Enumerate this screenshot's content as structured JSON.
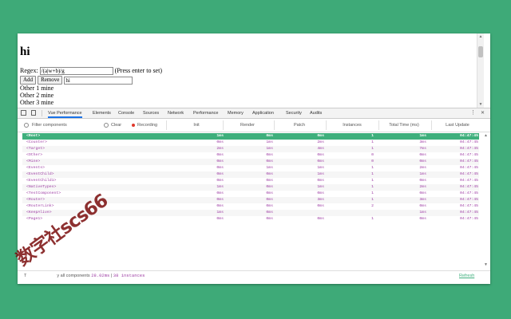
{
  "page": {
    "heading": "hi",
    "regex_label": "Regex:",
    "regex_value": "/(a|w+b)/g",
    "regex_hint": "(Press enter to set)",
    "add_button": "Add",
    "remove_button": "Remove",
    "new_item_value": "hi",
    "items": [
      "Other 1 mine",
      "Other 2 mine",
      "Other 3 mine"
    ]
  },
  "devtools": {
    "tabs": [
      "Vue Performance",
      "Elements",
      "Console",
      "Sources",
      "Network",
      "Performance",
      "Memory",
      "Application",
      "Security",
      "Audits"
    ],
    "active_tab": "Vue Performance",
    "accent": "#3eaf7c",
    "toolbar": {
      "filter_placeholder": "Filter components",
      "clear_label": "Clear",
      "recording_label": "Recording"
    },
    "columns": [
      "Init",
      "Render",
      "Patch",
      "Instances",
      "Total Time (ms)",
      "Last Update"
    ],
    "rows": [
      {
        "name": "<Root>",
        "init": "1ms",
        "render": "0ms",
        "patch": "0ms",
        "instances": "1",
        "total": "1ms",
        "last": "04:47:45",
        "selected": true
      },
      {
        "name": "<Counter>",
        "init": "0ms",
        "render": "1ms",
        "patch": "2ms",
        "instances": "1",
        "total": "3ms",
        "last": "04:47:45"
      },
      {
        "name": "<Target>",
        "init": "2ms",
        "render": "1ms",
        "patch": "4ms",
        "instances": "1",
        "total": "7ms",
        "last": "04:47:45"
      },
      {
        "name": "<Other>",
        "init": "0ms",
        "render": "0ms",
        "patch": "0ms",
        "instances": "0",
        "total": "0ms",
        "last": "04:47:45"
      },
      {
        "name": "<Mine>",
        "init": "0ms",
        "render": "0ms",
        "patch": "0ms",
        "instances": "0",
        "total": "0ms",
        "last": "04:47:45"
      },
      {
        "name": "<Events>",
        "init": "0ms",
        "render": "1ms",
        "patch": "1ms",
        "instances": "1",
        "total": "2ms",
        "last": "04:47:45"
      },
      {
        "name": "<EventChild>",
        "init": "0ms",
        "render": "0ms",
        "patch": "1ms",
        "instances": "1",
        "total": "1ms",
        "last": "04:47:45"
      },
      {
        "name": "<EventChild1>",
        "init": "0ms",
        "render": "0ms",
        "patch": "0ms",
        "instances": "1",
        "total": "0ms",
        "last": "04:47:45"
      },
      {
        "name": "<NativeTypes>",
        "init": "1ms",
        "render": "0ms",
        "patch": "1ms",
        "instances": "1",
        "total": "2ms",
        "last": "04:47:45"
      },
      {
        "name": "<TestComponent>",
        "init": "0ms",
        "render": "0ms",
        "patch": "0ms",
        "instances": "1",
        "total": "0ms",
        "last": "04:47:45"
      },
      {
        "name": "<Router>",
        "init": "0ms",
        "render": "0ms",
        "patch": "3ms",
        "instances": "1",
        "total": "3ms",
        "last": "04:47:45"
      },
      {
        "name": "<RouterLink>",
        "init": "0ms",
        "render": "0ms",
        "patch": "0ms",
        "instances": "2",
        "total": "0ms",
        "last": "04:47:45"
      },
      {
        "name": "<KeepAlive>",
        "init": "1ms",
        "render": "0ms",
        "patch": "",
        "instances": "",
        "total": "1ms",
        "last": "04:47:45"
      },
      {
        "name": "<Page1>",
        "init": "0ms",
        "render": "0ms",
        "patch": "0ms",
        "instances": "1",
        "total": "0ms",
        "last": "04:47:45"
      }
    ],
    "footer": {
      "text_prefix": "T",
      "text_mid": "y all components",
      "total_ms": "28.02ms",
      "instances_label": "38 instances",
      "refresh_label": "Refresh"
    }
  },
  "watermark": "数字社scs66"
}
